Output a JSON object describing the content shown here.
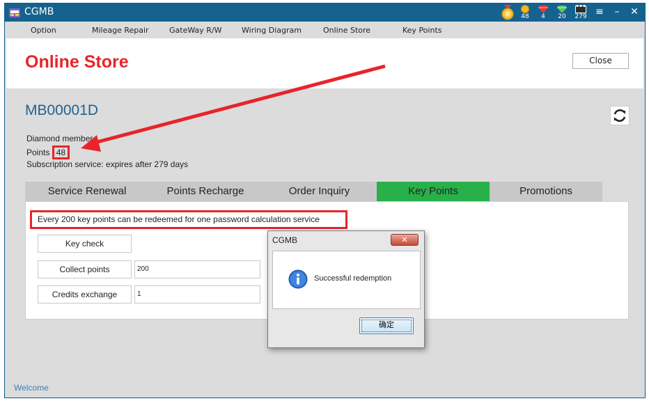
{
  "window": {
    "title": "CGMB",
    "stats": [
      {
        "icon": "medal-icon",
        "value": ""
      },
      {
        "icon": "gold-coin-icon",
        "value": "48"
      },
      {
        "icon": "red-gem-icon",
        "value": "4"
      },
      {
        "icon": "green-gem-icon",
        "value": "20"
      },
      {
        "icon": "calendar-icon",
        "value": "279"
      }
    ]
  },
  "menu": {
    "items": [
      "Option",
      "Mileage Repair",
      "GateWay R/W",
      "Wiring Diagram",
      "Online Store",
      "Key Points"
    ]
  },
  "header": {
    "title": "Online Store",
    "close_label": "Close"
  },
  "account": {
    "id": "MB00001D",
    "membership": "Diamond member",
    "points_label": "Points",
    "points_value": "48",
    "subscription": "Subscription service: expires after 279 days"
  },
  "tabs": [
    {
      "label": "Service Renewal",
      "active": false
    },
    {
      "label": "Points Recharge",
      "active": false
    },
    {
      "label": "Order Inquiry",
      "active": false
    },
    {
      "label": "Key Points",
      "active": true
    },
    {
      "label": "Promotions",
      "active": false
    }
  ],
  "keypoints": {
    "notice": "Every 200 key points can be redeemed for one password calculation service",
    "key_check_label": "Key check",
    "collect_points_label": "Collect points",
    "collect_points_value": "200",
    "credits_exchange_label": "Credits exchange",
    "credits_exchange_value": "1"
  },
  "status": {
    "text": "Welcome"
  },
  "dialog": {
    "title": "CGMB",
    "close_glyph": "✕",
    "message": "Successful redemption",
    "ok_label": "确定"
  },
  "colors": {
    "accent_red": "#e8242a",
    "title_bar": "#16628f",
    "active_tab": "#28b04b",
    "account_blue": "#21628f"
  }
}
